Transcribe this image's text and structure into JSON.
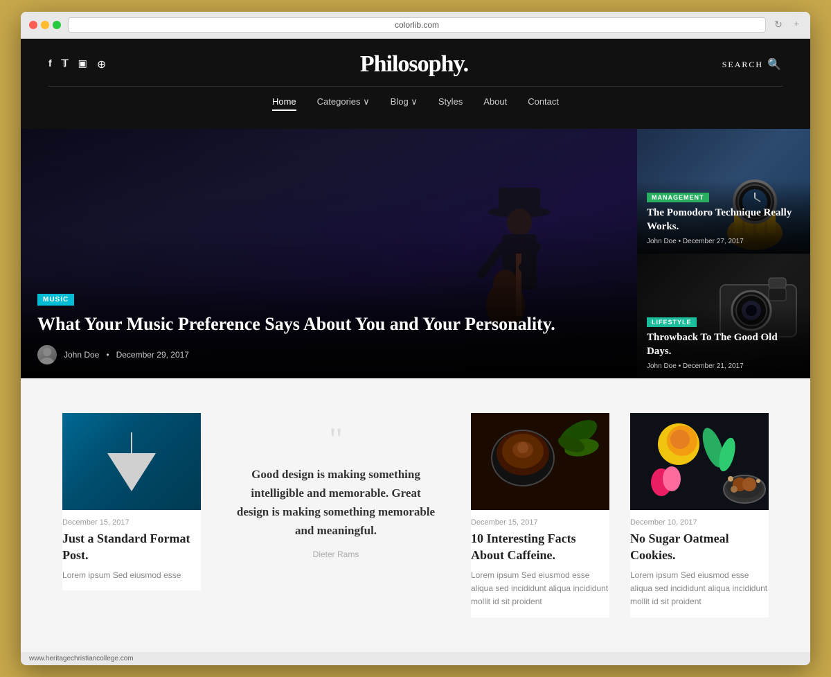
{
  "browser": {
    "url": "colorlib.com",
    "refresh_label": "↻",
    "new_tab_label": "+",
    "status_bar": "www.heritagechristiancollege.com"
  },
  "header": {
    "title": "Philosophy.",
    "search_label": "SEARCH",
    "social_icons": [
      "f",
      "𝕋",
      "◻",
      "⊕"
    ],
    "nav_items": [
      {
        "label": "Home",
        "active": true
      },
      {
        "label": "Categories ∨",
        "active": false
      },
      {
        "label": "Blog ∨",
        "active": false
      },
      {
        "label": "Styles",
        "active": false
      },
      {
        "label": "About",
        "active": false
      },
      {
        "label": "Contact",
        "active": false
      }
    ]
  },
  "hero": {
    "main": {
      "tag": "MUSIC",
      "tag_color": "#00bcd4",
      "title": "What Your Music Preference Says About You and Your Personality.",
      "author": "John Doe",
      "date": "December 29, 2017"
    },
    "side_cards": [
      {
        "tag": "MANAGEMENT",
        "tag_color": "#27ae60",
        "title": "The Pomodoro Technique Really Works.",
        "author": "John Doe",
        "date": "December 27, 2017"
      },
      {
        "tag": "LIFESTYLE",
        "tag_color": "#1abc9c",
        "title": "Throwback To The Good Old Days.",
        "author": "John Doe",
        "date": "December 21, 2017"
      }
    ]
  },
  "content": {
    "posts": [
      {
        "type": "image",
        "image_desc": "lamp",
        "date": "December 15, 2017",
        "title": "Just a Standard Format Post.",
        "excerpt": "Lorem ipsum Sed eiusmod esse"
      },
      {
        "type": "quote",
        "quote_mark": "❝",
        "text": "Good design is making something intelligible and memorable. Great design is making something memorable and meaningful.",
        "author": "Dieter Rams"
      },
      {
        "type": "image",
        "image_desc": "coffee",
        "date": "December 15, 2017",
        "title": "10 Interesting Facts About Caffeine.",
        "excerpt": "Lorem ipsum Sed eiusmod esse aliqua sed incididunt aliqua incididunt mollit id sit proident"
      },
      {
        "type": "image",
        "image_desc": "flowers",
        "date": "December 10, 2017",
        "title": "No Sugar Oatmeal Cookies.",
        "excerpt": "Lorem ipsum Sed eiusmod esse aliqua sed incididunt aliqua incididunt mollit id sit proident"
      }
    ]
  }
}
